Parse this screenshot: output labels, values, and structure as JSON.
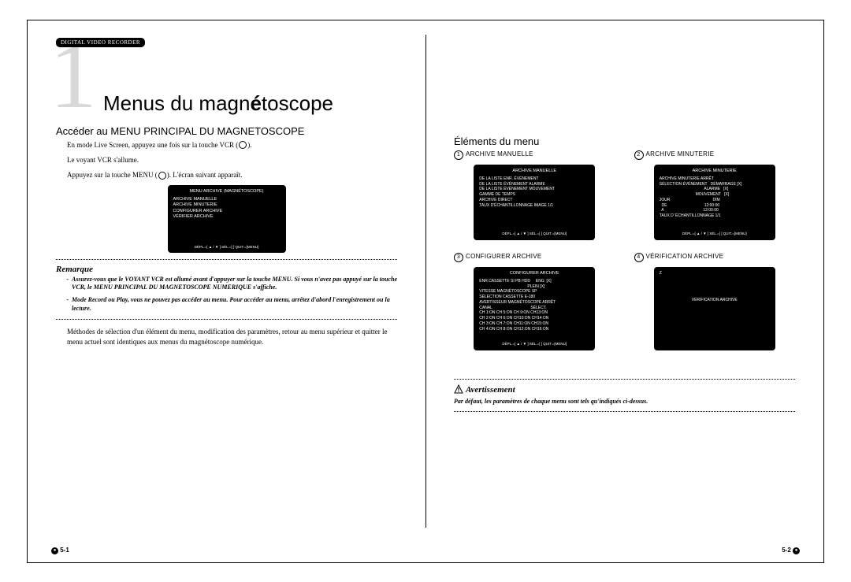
{
  "header": {
    "dvr": "DIGITAL VIDEO RECORDER"
  },
  "chapter": {
    "big": "1",
    "title_plain": "Menus du magn",
    "title_bold": "é",
    "title_rest": "toscope"
  },
  "left": {
    "sect_title": "Accéder au MENU PRINCIPAL DU MAGNETOSCOPE",
    "line1_a": "En mode Live Screen, appuyez une fois sur la touche VCR (",
    "line1_b": ").",
    "line2": "Le voyant VCR s'allume.",
    "line3_a": "Appuyez sur la touche MENU (",
    "line3_b": "). L'écran suivant apparaît.",
    "screen": {
      "title": "MENU ARCHIVE (MAGNÉTOSCOPE)",
      "items": [
        "ARCHIVE MANUELLE",
        "ARCHIVE MINUTERIE",
        "CONFIGURER ARCHIVE",
        "VÉRIFIER ARCHIVE"
      ],
      "footer": "DÉPL.=[ ▲ / ▼ ]  SÉL.=[   ]  QUIT.=[MENU]"
    },
    "remarque_h": "Remarque",
    "remarques": [
      "Assurez-vous que le VOYANT VCR est allumé avant d'appuyer sur la touche MENU. Si vous n'avez pas appuyé sur la touche VCR, le MENU PRINCIPAL DU MAGNETOSCOPE NUMERIQUE s'affiche.",
      "Mode Record ou Play, vous ne pouvez pas accéder au menu. Pour accéder au menu, arrêtez d'abord l'enregistrement ou la lecture."
    ],
    "tail": "Méthodes de sélection d'un élément du menu, modification des paramètres, retour au menu supérieur et quitter le menu actuel sont identiques aux menus du magnétoscope numérique.",
    "pageno": "5-1"
  },
  "right": {
    "sect_title": "Éléments du menu",
    "items": [
      {
        "num": "①",
        "label": "ARCHIVE MANUELLE",
        "screen": {
          "title": "ARCHIVE MANUELLE",
          "lines": [
            "DE LA LISTE ENR. ÉVÉNEMENT",
            "DE LA LISTE ÉVÉNEMENT ALARME",
            "DE LA LISTE ÉVÉNEMENT MOUVEMENT",
            "GAMME DE TEMPS",
            "ARCHIVE DIRECT",
            "TAUX D'ÉCHANTILLONNAGE IMAGE        1/1"
          ],
          "footer": "DÉPL.=[ ▲ / ▼ ] SÉL.=[   ] QUIT.=[MENU]"
        }
      },
      {
        "num": "②",
        "label": "ARCHIVE MINUTERIE",
        "screen": {
          "title": "ARCHIVE MINUTERIE",
          "lines": [
            "ARCHIVE MINUTERIE             ARRÊT",
            "SÉLECTION ÉVÉNEMENT   DÉMARRAGE [X]",
            "                                         ALARME   [X]",
            "                                 MOUVEMENT   [X]",
            "JOUR                                       DIM",
            "  DE                                  12:00:00",
            "  A                                    12:00:00",
            "TAUX D' ÉCHANTILLONNAGE 1/1"
          ],
          "footer": "DÉPL.=[ ▲ / ▼ ] SÉL.=[   ] QUIT.=[MENU]"
        }
      },
      {
        "num": "③",
        "label": "CONFIGURER ARCHIVE",
        "screen": {
          "title": "CONFIGURER ARCHIVE",
          "lines": [
            "ENR.CASSETTE SI PB HDD     ENG  [X]",
            "                                            PLEIN [X]",
            "VITESSE MAGNÉTOSCOPE  SP",
            "SÉLECTION CASSETTE   E-180",
            "AVERTISSEUR MAGNÉTOSCOPE ARRÊT",
            "CANAL                                   SÉLECT.",
            "CH 1:ON  CH 5:ON  CH 9:ON  CH13:ON",
            "CH 2:ON  CH 6:ON  CH10:ON  CH14:ON",
            "CH 3:ON  CH 7:ON  CH11:ON  CH15:ON",
            "CH 4:ON  CH 8:ON  CH12:ON  CH16:ON"
          ],
          "footer": "DÉPL.=[ ▲ / ▼ ] SÉL.=[   ] QUIT.=[MENU]"
        }
      },
      {
        "num": "④",
        "label": "VÉRIFICATION ARCHIVE",
        "screen": {
          "title": "",
          "z": "Z",
          "lines": [
            "",
            "",
            "          VÉRIFICATION ARCHIVE"
          ],
          "footer": ""
        }
      }
    ],
    "warn_h": "Avertissement",
    "warn_t": "Par défaut, les paramètres de chaque menu sont tels qu'indiqués ci-dessus.",
    "pageno": "5-2"
  }
}
